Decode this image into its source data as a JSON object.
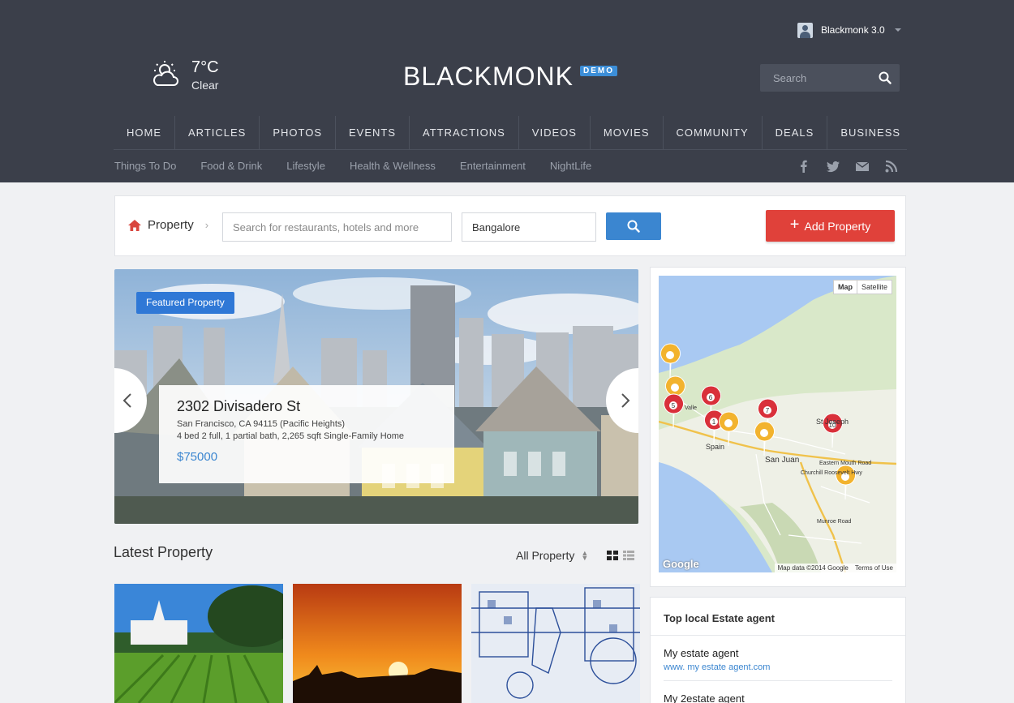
{
  "header": {
    "user_name": "Blackmonk 3.0",
    "weather": {
      "temp": "7°C",
      "condition": "Clear"
    },
    "logo": "BLACKMONK",
    "logo_badge": "DEMO",
    "search_placeholder": "Search",
    "nav": [
      "HOME",
      "ARTICLES",
      "PHOTOS",
      "EVENTS",
      "ATTRACTIONS",
      "VIDEOS",
      "MOVIES",
      "COMMUNITY",
      "DEALS",
      "BUSINESS"
    ],
    "subnav": [
      "Things To Do",
      "Food & Drink",
      "Lifestyle",
      "Health & Wellness",
      "Entertainment",
      "NightLife"
    ],
    "social_icons": [
      "facebook-icon",
      "twitter-icon",
      "mail-icon",
      "rss-icon"
    ]
  },
  "toolbar": {
    "breadcrumb": "Property",
    "search_placeholder": "Search for restaurants, hotels and more",
    "location": "Bangalore",
    "add_label": "Add Property"
  },
  "featured": {
    "tag": "Featured Property",
    "address": "2302 Divisadero St",
    "location": "San Francisco, CA 94115 (Pacific Heights)",
    "details": "4 bed  2 full, 1 partial bath, 2,265 sqft  Single-Family Home",
    "price": "$75000"
  },
  "map": {
    "btn_map": "Map",
    "btn_satellite": "Satellite",
    "labels": [
      "St Joseph",
      "San Juan",
      "Eastern Mouth Road",
      "Churchill Roosevelt Hwy",
      "Uriah Butler Hwy",
      "Munroe Road",
      "Spain",
      "Valle"
    ],
    "brand": "Google",
    "footer": [
      "Map data ©2014 Google",
      "Terms of Use"
    ],
    "markers": [
      "1",
      "5",
      "6",
      "7",
      "10"
    ]
  },
  "latest": {
    "title": "Latest Property",
    "filter": "All Property"
  },
  "agents": {
    "title": "Top local Estate agent",
    "items": [
      {
        "name": "My estate agent",
        "link": "www. my estate agent.com"
      },
      {
        "name": "My 2estate agent",
        "link": ""
      }
    ]
  },
  "colors": {
    "header_bg": "#3b3f4a",
    "accent_blue": "#3b86d0",
    "accent_red": "#e0413a"
  }
}
